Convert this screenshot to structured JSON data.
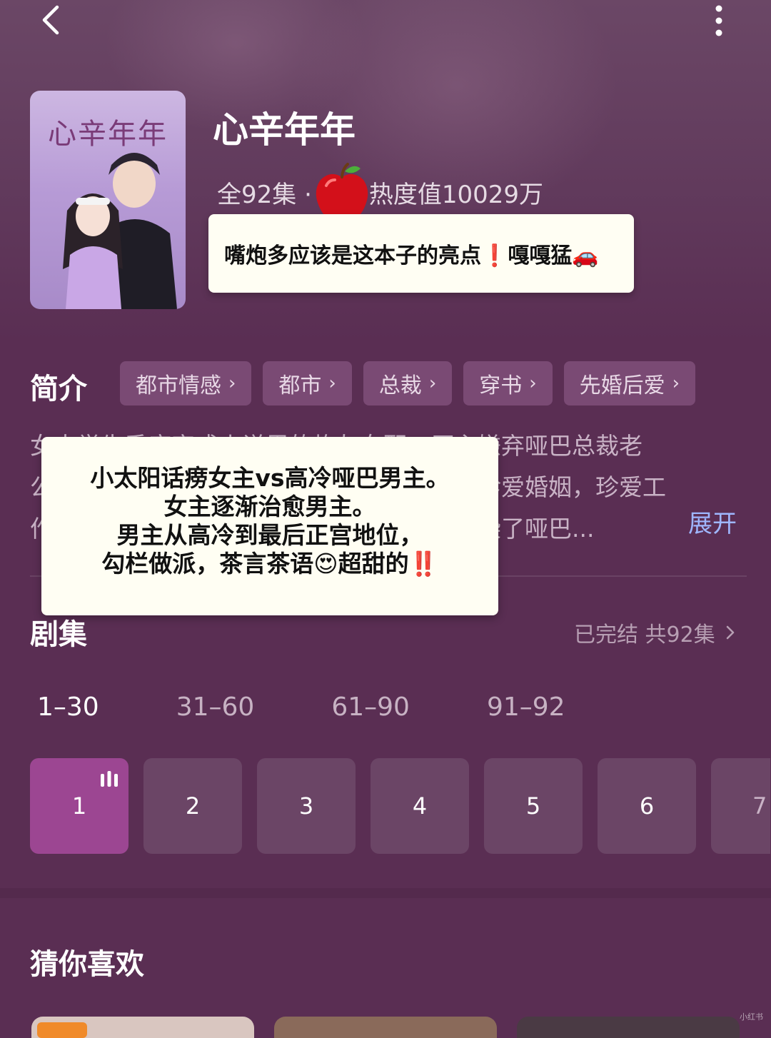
{
  "header": {
    "back_icon": "chevron-left-icon",
    "more_icon": "vertical-ellipsis-icon"
  },
  "show": {
    "poster_title": "心辛年年",
    "title": "心辛年年",
    "episodes_total": "全92集 ·",
    "heat": "热度值10029万",
    "heat_icon": "red-apple-icon"
  },
  "comment_card": {
    "text": "嘴炮多应该是这本子的亮点❗️嘎嘎猛🚗"
  },
  "intro": {
    "label": "简介",
    "tags": [
      "都市情感",
      "都市",
      "总裁",
      "穿书",
      "先婚后爱"
    ],
    "synopsis_lines": [
      "女大学生季席穿成小说里的炮灰女配，原主嫌弃哑巴总裁老",
      "公……………………………………………要珍爱婚姻，珍爱工",
      "作……………………………………………感染了哑巴..."
    ],
    "expand_label": "展开"
  },
  "overlay_card": {
    "lines": [
      "小太阳话痨女主vs高冷哑巴男主。",
      "女主逐渐治愈男主。",
      "男主从高冷到最后正宫地位，",
      "勾栏做派，茶言茶语😍超甜的‼️"
    ]
  },
  "episodes": {
    "label": "剧集",
    "status": "已完结 共92集",
    "ranges": [
      "1–30",
      "31–60",
      "61–90",
      "91–92"
    ],
    "active_range": 0,
    "items": [
      "1",
      "2",
      "3",
      "4",
      "5",
      "6",
      "7"
    ],
    "active_item": 0
  },
  "recommend": {
    "label": "猜你喜欢"
  },
  "colors": {
    "background": "#5a2e53",
    "active_episode": "#9c4692",
    "expand_link": "#9fb7ff"
  },
  "watermark": "小红书"
}
